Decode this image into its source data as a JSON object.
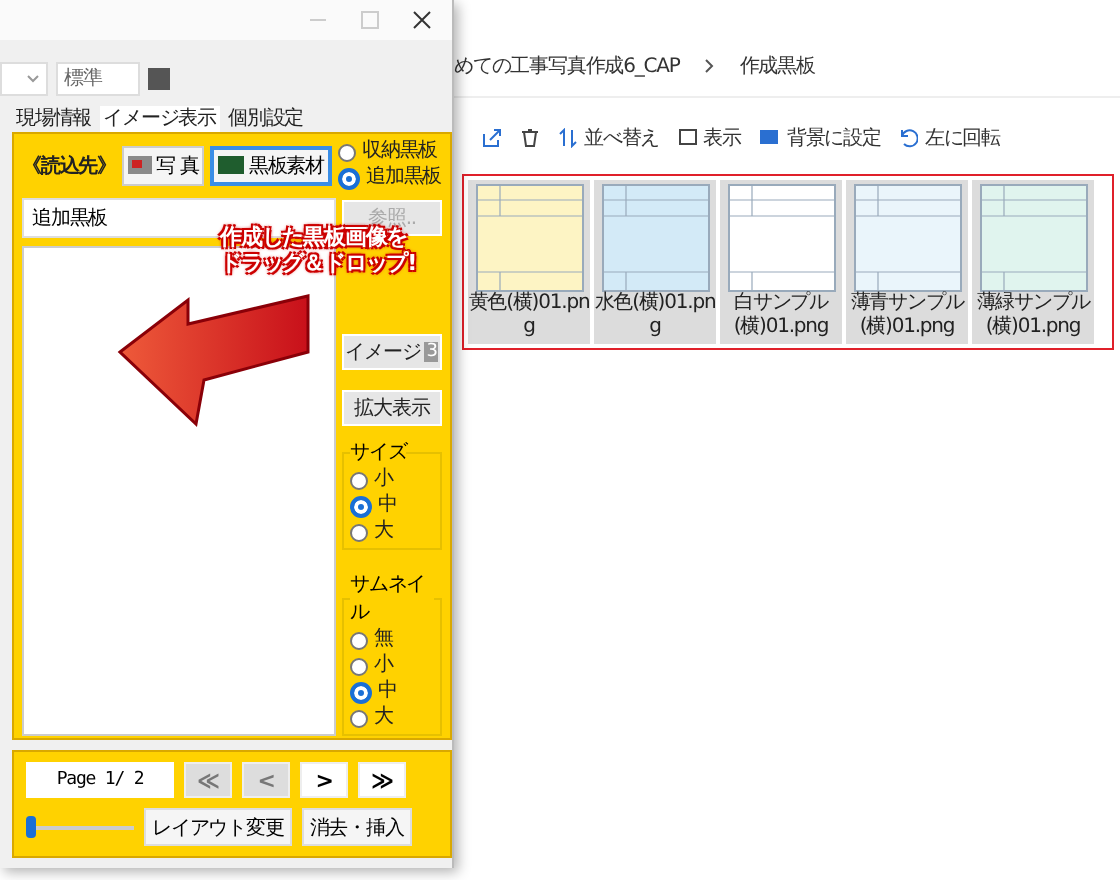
{
  "app": {
    "toolbar": {
      "dropdown": "標準"
    },
    "tabs": [
      {
        "label": "現場情報",
        "selected": false
      },
      {
        "label": "イメージ表示",
        "selected": true
      },
      {
        "label": "個別設定",
        "selected": false
      }
    ],
    "source_label": "《読込先》",
    "source_buttons": [
      {
        "label": "写 真",
        "kind": "photo",
        "selected": false
      },
      {
        "label": "黒板素材",
        "kind": "board",
        "selected": true
      }
    ],
    "source_radios": [
      {
        "label": "収納黒板",
        "selected": false
      },
      {
        "label": "追加黒板",
        "selected": true
      }
    ],
    "folder_field": {
      "value": "追加黒板"
    },
    "browse_button": {
      "label": "参照..",
      "disabled": true
    },
    "image_button": {
      "label": "イメージ",
      "count": "3"
    },
    "zoom_button": "拡大表示",
    "size_group": {
      "title": "サイズ",
      "options": [
        {
          "label": "小",
          "selected": false
        },
        {
          "label": "中",
          "selected": true
        },
        {
          "label": "大",
          "selected": false
        }
      ]
    },
    "thumb_group": {
      "title": "サムネイル",
      "options": [
        {
          "label": "無",
          "selected": false
        },
        {
          "label": "小",
          "selected": false
        },
        {
          "label": "中",
          "selected": true
        },
        {
          "label": "大",
          "selected": false
        }
      ]
    },
    "page_field": "Page 1/ 2",
    "nav_buttons": [
      {
        "label": "≪",
        "disabled": true
      },
      {
        "label": "<",
        "disabled": true
      },
      {
        "label": ">",
        "disabled": false
      },
      {
        "label": "≫",
        "disabled": false
      }
    ],
    "slider": {
      "level": 0.0
    },
    "action_buttons": [
      "レイアウト変更",
      "消去・挿入"
    ]
  },
  "explorer": {
    "breadcrumb": [
      "めての工事写真作成6_CAP",
      "作成黒板"
    ],
    "toolbar": [
      {
        "kind": "share"
      },
      {
        "kind": "trash"
      },
      {
        "label": "並べ替え",
        "kind": "sort"
      },
      {
        "label": "表示",
        "kind": "view"
      },
      {
        "label": "背景に設定",
        "kind": "wallpaper"
      },
      {
        "label": "左に回転",
        "kind": "rotate"
      }
    ],
    "files": [
      {
        "name": "黄色(横)01.png",
        "color": "#fdf4c4"
      },
      {
        "name": "水色(横)01.png",
        "color": "#d3eaf7"
      },
      {
        "name": "白サンプル(横)01.png",
        "color": "#ffffff"
      },
      {
        "name": "薄青サンプル(横)01.png",
        "color": "#eaf5fb"
      },
      {
        "name": "薄緑サンプル(横)01.png",
        "color": "#e0f4ee"
      }
    ]
  },
  "callout": [
    "作成した黒板画像を",
    "ドラッグ＆ドロップ!"
  ]
}
